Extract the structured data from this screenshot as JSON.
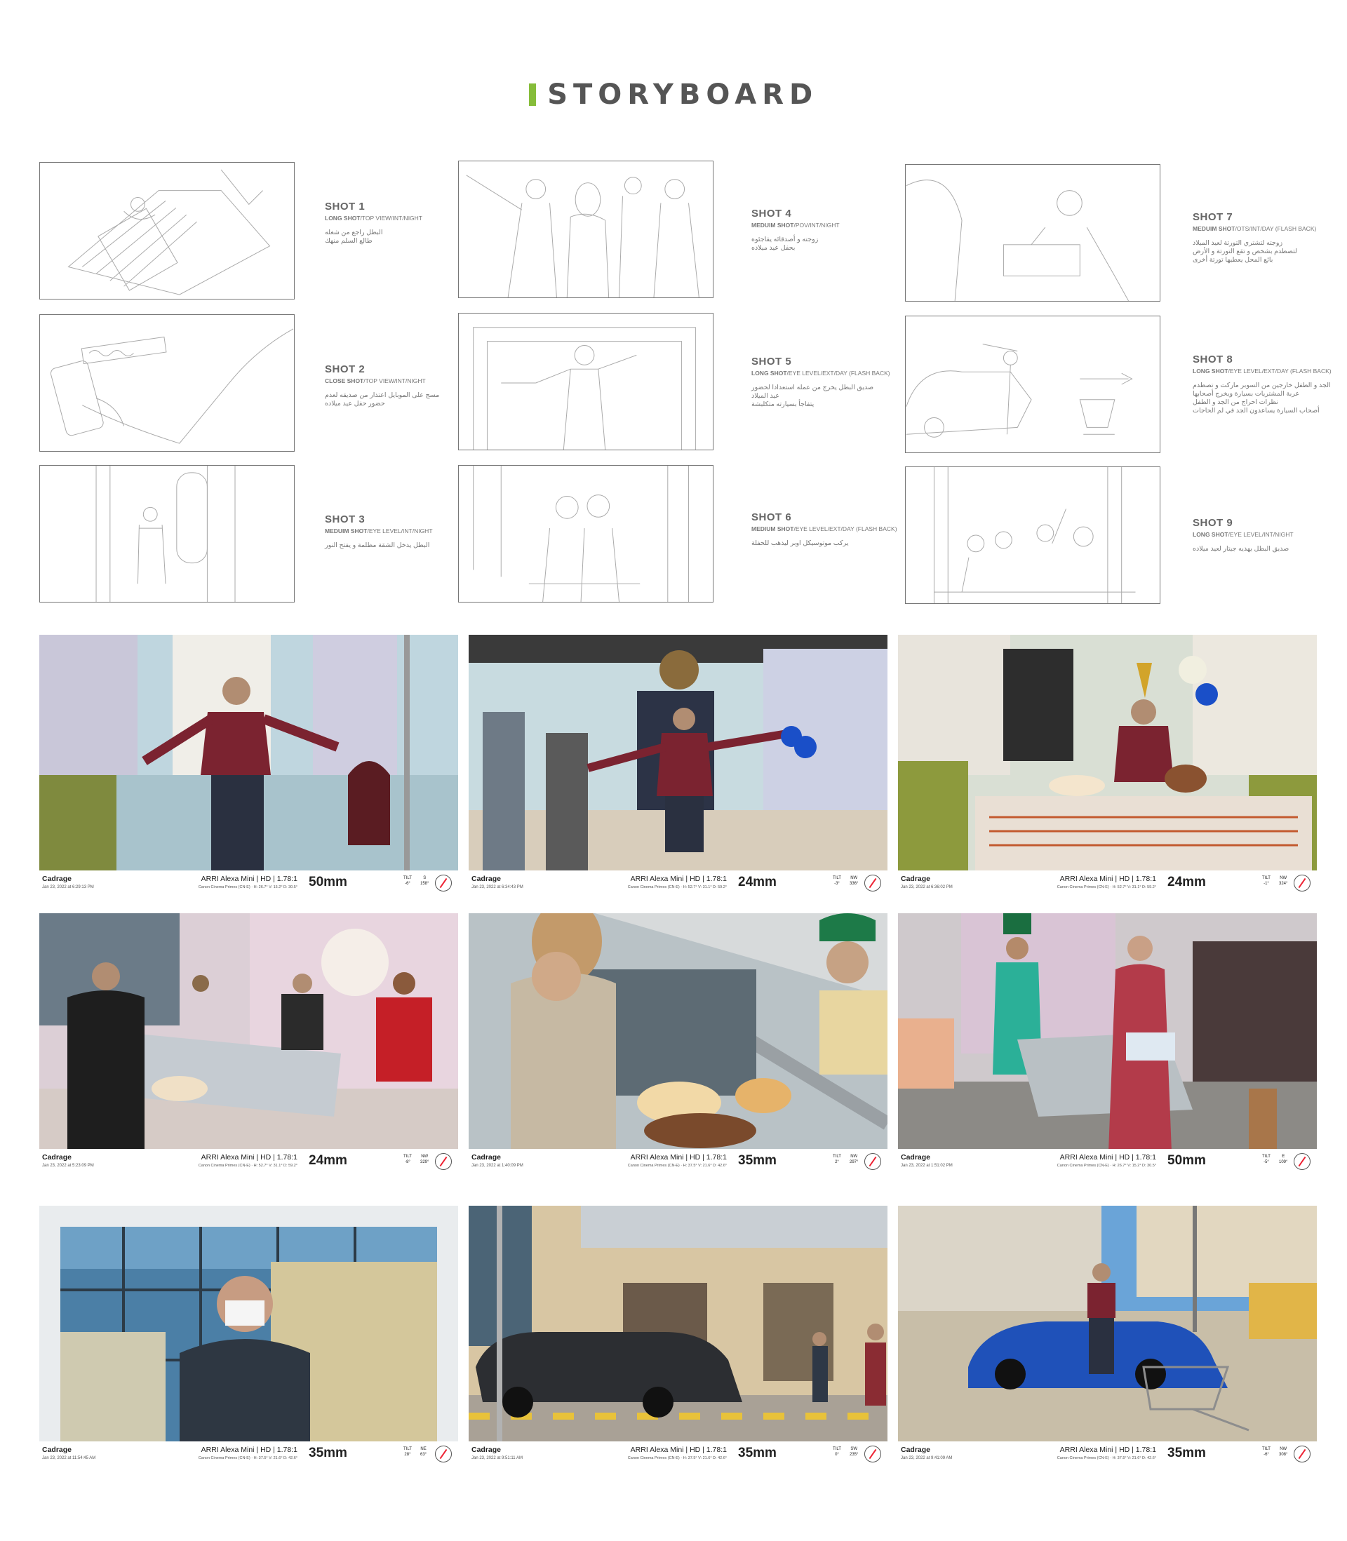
{
  "header": {
    "title": "STORYBOARD",
    "accent_color": "#86bd3a"
  },
  "shots": [
    {
      "num": "SHOT 1",
      "type": "LONG SHOT",
      "rest": "/TOP VIEW/INT/NIGHT",
      "desc": [
        "البطل راجع من شغله",
        "طالع السلم منهك"
      ]
    },
    {
      "num": "SHOT 2",
      "type": "CLOSE SHOT",
      "rest": "/TOP VIEW/INT/NIGHT",
      "desc": [
        "مسج على الموبايل اعتذار من صديقه لعدم",
        "حضور حفل عيد ميلاده"
      ]
    },
    {
      "num": "SHOT 3",
      "type": "MEDUIM SHOT",
      "rest": "/EYE LEVEL/INT/NIGHT",
      "desc": [
        "البطل يدخل الشقة مظلمة و يفتح النور"
      ]
    },
    {
      "num": "SHOT 4",
      "type": "MEDUIM SHOT",
      "rest": "/POV/INT/NIGHT",
      "desc": [
        "زوجته و أصدقائه يفاجئوه",
        "بحفل عيد ميلاده"
      ]
    },
    {
      "num": "SHOT 5",
      "type": "LONG SHOT",
      "rest": "/EYE LEVEL/EXT/DAY (FLASH BACK)",
      "desc": [
        "صديق البطل يخرج من عمله استعدادا لحضور",
        "عيد الميلاد",
        "يتفاجأ بسيارته متكلبشة"
      ]
    },
    {
      "num": "SHOT 6",
      "type": "MEDIUM SHOT",
      "rest": "/EYE LEVEL/EXT/DAY (FLASH BACK)",
      "desc": [
        "يركب موتوسيكل اوبر ليذهب للحفلة"
      ]
    },
    {
      "num": "SHOT 7",
      "type": "MEDUIM SHOT",
      "rest": "/OTS/INT/DAY (FLASH BACK)",
      "desc": [
        "زوجته لتشتري التورتة لعيد الميلاد",
        "لتصطدم بشخص و تقع التورتة و الأرض",
        "بائع المحل يعطيها تورتة أخرى"
      ]
    },
    {
      "num": "SHOT 8",
      "type": "LONG SHOT",
      "rest": "/EYE LEVEL/EXT/DAY (FLASH BACK)",
      "desc": [
        "الجد و الطفل خارجين من السوبر ماركت و تصطدم",
        "عربة المشتريات بسيارة ويخرج أصحابها",
        "نظرات احراج من الجد و الطفل",
        "أصحاب السيارة يساعدون الجد في لم الحاجات"
      ]
    },
    {
      "num": "SHOT 9",
      "type": "LONG SHOT",
      "rest": "/EYE LEVEL/INT/NIGHT",
      "desc": [
        "صديق البطل يهديه جيتار لعيد ميلاده"
      ]
    }
  ],
  "photos": [
    {
      "cadrage": "Cadrage",
      "datetime": "Jan 23, 2022 at 6:29:13 PM",
      "camera": "ARRI Alexa Mini  |  HD  |  1.78:1",
      "lens": "Canon Cinema Primes (CN-E)  ·  H: 26.7°  V: 15.2°  D: 30.5°",
      "focal": "50mm",
      "tilt_label": "TILT",
      "tilt": "-6°",
      "dir": "S",
      "deg": "158°"
    },
    {
      "cadrage": "Cadrage",
      "datetime": "Jan 23, 2022 at 6:34:43 PM",
      "camera": "ARRI Alexa Mini  |  HD  |  1.78:1",
      "lens": "Canon Cinema Primes (CN-E)  ·  H: 52.7°  V: 31.1°  D: 59.2°",
      "focal": "24mm",
      "tilt_label": "TILT",
      "tilt": "-3°",
      "dir": "NW",
      "deg": "336°"
    },
    {
      "cadrage": "Cadrage",
      "datetime": "Jan 23, 2022 at 6:36:02 PM",
      "camera": "ARRI Alexa Mini  |  HD  |  1.78:1",
      "lens": "Canon Cinema Primes (CN-E)  ·  H: 52.7°  V: 31.1°  D: 59.2°",
      "focal": "24mm",
      "tilt_label": "TILT",
      "tilt": "-1°",
      "dir": "NW",
      "deg": "324°"
    },
    {
      "cadrage": "Cadrage",
      "datetime": "Jan 23, 2022 at 5:23:09 PM",
      "camera": "ARRI Alexa Mini  |  HD  |  1.78:1",
      "lens": "Canon Cinema Primes (CN-E)  ·  H: 52.7°  V: 31.1°  D: 59.2°",
      "focal": "24mm",
      "tilt_label": "TILT",
      "tilt": "-8°",
      "dir": "NW",
      "deg": "329°"
    },
    {
      "cadrage": "Cadrage",
      "datetime": "Jan 23, 2022 at 1:40:09 PM",
      "camera": "ARRI Alexa Mini  |  HD  |  1.78:1",
      "lens": "Canon Cinema Primes (CN-E)  ·  H: 37.5°  V: 21.6°  D: 42.6°",
      "focal": "35mm",
      "tilt_label": "TILT",
      "tilt": "2°",
      "dir": "NW",
      "deg": "297°"
    },
    {
      "cadrage": "Cadrage",
      "datetime": "Jan 23, 2022 at 1:51:02 PM",
      "camera": "ARRI Alexa Mini  |  HD  |  1.78:1",
      "lens": "Canon Cinema Primes (CN-E)  ·  H: 26.7°  V: 15.2°  D: 30.5°",
      "focal": "50mm",
      "tilt_label": "TILT",
      "tilt": "-5°",
      "dir": "E",
      "deg": "109°"
    },
    {
      "cadrage": "Cadrage",
      "datetime": "Jan 23, 2022 at 11:54:45 AM",
      "camera": "ARRI Alexa Mini  |  HD  |  1.78:1",
      "lens": "Canon Cinema Primes (CN-E)  ·  H: 37.5°  V: 21.6°  D: 42.6°",
      "focal": "35mm",
      "tilt_label": "TILT",
      "tilt": "28°",
      "dir": "NE",
      "deg": "63°"
    },
    {
      "cadrage": "Cadrage",
      "datetime": "Jan 23, 2022 at 9:51:11 AM",
      "camera": "ARRI Alexa Mini  |  HD  |  1.78:1",
      "lens": "Canon Cinema Primes (CN-E)  ·  H: 37.5°  V: 21.6°  D: 42.6°",
      "focal": "35mm",
      "tilt_label": "TILT",
      "tilt": "0°",
      "dir": "SW",
      "deg": "235°"
    },
    {
      "cadrage": "Cadrage",
      "datetime": "Jan 23, 2022 at 9:41:09 AM",
      "camera": "ARRI Alexa Mini  |  HD  |  1.78:1",
      "lens": "Canon Cinema Primes (CN-E)  ·  H: 37.5°  V: 21.6°  D: 42.6°",
      "focal": "35mm",
      "tilt_label": "TILT",
      "tilt": "-6°",
      "dir": "NW",
      "deg": "308°"
    }
  ]
}
